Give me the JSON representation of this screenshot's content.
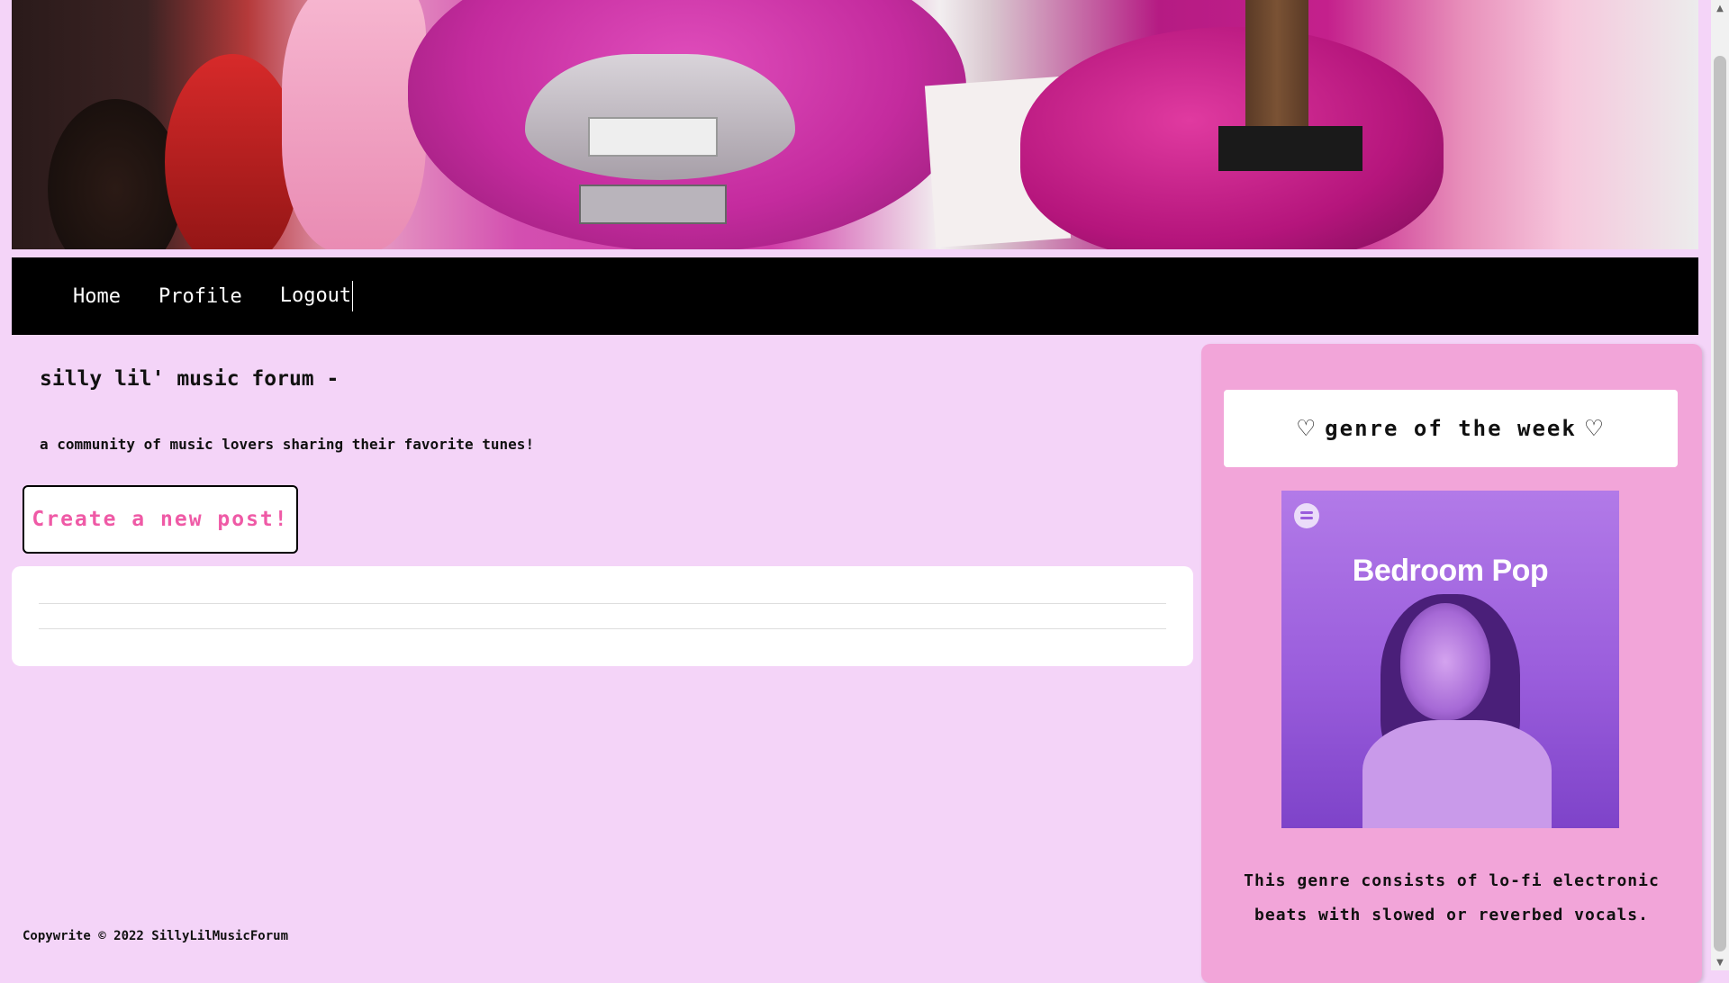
{
  "nav": {
    "home": "Home",
    "profile": "Profile",
    "logout": "Logout"
  },
  "main": {
    "title": "silly lil' music forum -",
    "tagline": "a community of music lovers sharing their favorite tunes!",
    "create_post_label": "Create a new post!"
  },
  "sidebar": {
    "heading": "genre of the week",
    "heart_glyph": "♡",
    "cover_title": "Bedroom Pop",
    "description": "This genre consists of lo-fi electronic beats with slowed or reverbed vocals."
  },
  "footer": {
    "copyright": "Copywrite © 2022 SillyLilMusicForum"
  },
  "colors": {
    "background": "#f4d4f8",
    "sidebar": "#f2a5d9",
    "nav": "#000000",
    "accent": "#ef5aa6"
  }
}
